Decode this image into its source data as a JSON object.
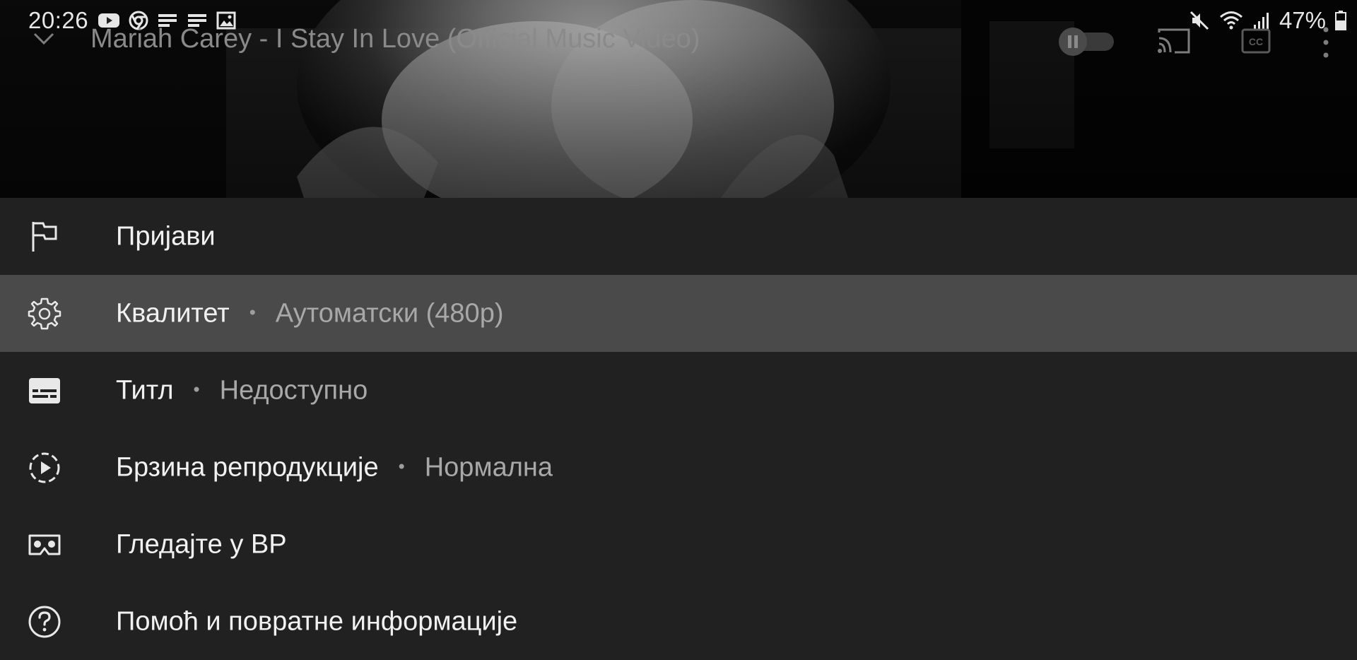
{
  "status_bar": {
    "time": "20:26",
    "battery": "47%",
    "left_icons": [
      "youtube-icon",
      "chrome-icon",
      "notes-icon",
      "notes-icon",
      "gallery-icon"
    ],
    "right_icons": [
      "mute-icon",
      "wifi-icon",
      "signal-icon",
      "battery-icon"
    ]
  },
  "player": {
    "title": "Mariah Carey - I Stay In Love (Official Music Video)",
    "controls": [
      "collapse-icon",
      "pause-toggle",
      "cast-icon",
      "cc-icon",
      "more-icon"
    ]
  },
  "menu": {
    "items": [
      {
        "icon": "flag-icon",
        "label": "Пријави",
        "value": ""
      },
      {
        "icon": "gear-icon",
        "label": "Квалитет",
        "value": "Аутоматски (480p)"
      },
      {
        "icon": "subtitles-icon",
        "label": "Титл",
        "value": "Недоступно"
      },
      {
        "icon": "playback-speed-icon",
        "label": "Брзина репродукције",
        "value": "Нормална"
      },
      {
        "icon": "vr-icon",
        "label": "Гледајте у ВР",
        "value": ""
      },
      {
        "icon": "help-icon",
        "label": "Помоћ и повратне информације",
        "value": ""
      }
    ],
    "separator": "•"
  },
  "colors": {
    "sheet_bg": "#212121",
    "highlight_bg": "#4a4a4a",
    "text": "#f1f1f1",
    "secondary": "#a8a8a8"
  }
}
